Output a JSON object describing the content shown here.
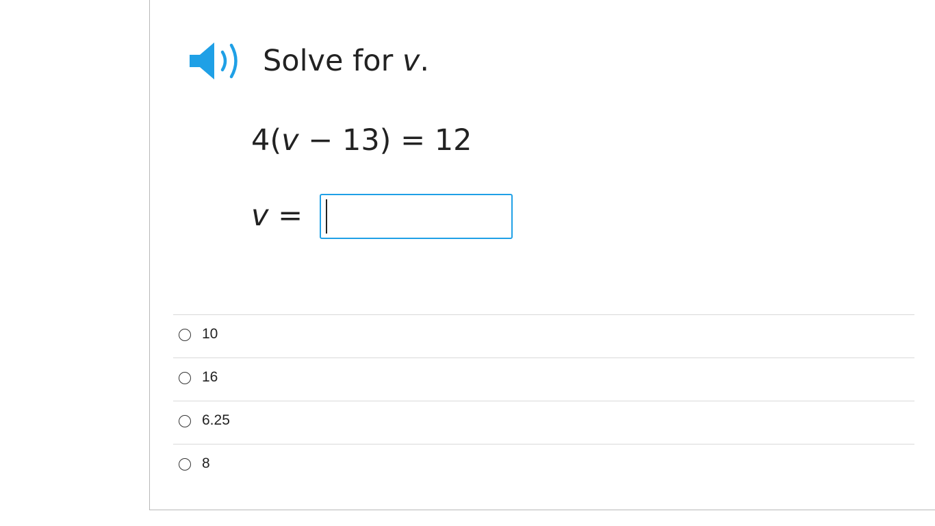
{
  "question": {
    "prompt_prefix": "Solve for ",
    "prompt_variable": "v",
    "prompt_suffix": ".",
    "equation": {
      "coefficient": "4(",
      "variable": "v",
      "rest": " − 13) = 12"
    },
    "answer_label_variable": "v",
    "answer_label_rest": " =",
    "answer_value": ""
  },
  "choices": [
    {
      "label": "10"
    },
    {
      "label": "16"
    },
    {
      "label": "6.25"
    },
    {
      "label": "8"
    }
  ],
  "colors": {
    "accent": "#1fa0e6",
    "text": "#222222",
    "divider": "#d9d9d9"
  },
  "icons": {
    "audio": "speaker-icon"
  }
}
